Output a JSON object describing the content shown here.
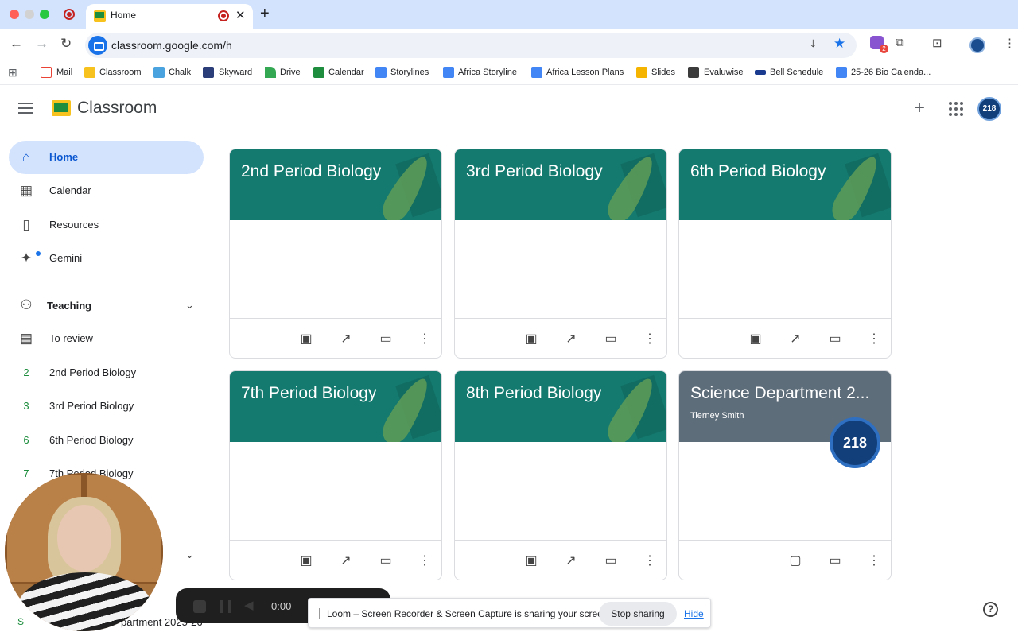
{
  "browser": {
    "tab_title": "Home",
    "url": "classroom.google.com/h",
    "bookmarks": [
      "Mail",
      "Classroom",
      "Chalk",
      "Skyward",
      "Drive",
      "Calendar",
      "Storylines",
      "Africa Storyline",
      "Africa Lesson Plans",
      "Slides",
      "Evaluwise",
      "Bell Schedule",
      "25-26 Bio Calenda..."
    ],
    "extension_badge": "2"
  },
  "app": {
    "title": "Classroom",
    "avatar_text": "218"
  },
  "sidebar": {
    "nav": [
      {
        "label": "Home",
        "icon": "home-icon"
      },
      {
        "label": "Calendar",
        "icon": "calendar-icon"
      },
      {
        "label": "Resources",
        "icon": "resources-icon"
      },
      {
        "label": "Gemini",
        "icon": "gemini-icon"
      }
    ],
    "teaching_label": "Teaching",
    "to_review": "To review",
    "classes": [
      {
        "letter": "2",
        "label": "2nd Period Biology"
      },
      {
        "letter": "3",
        "label": "3rd Period Biology"
      },
      {
        "letter": "6",
        "label": "6th Period Biology"
      },
      {
        "letter": "7",
        "label": "7th Period Biology"
      }
    ],
    "bottom_letter": "S",
    "bottom_label": "partment 2025-26"
  },
  "cards": [
    {
      "title": "2nd Period Biology",
      "subtitle": ""
    },
    {
      "title": "3rd Period Biology",
      "subtitle": ""
    },
    {
      "title": "6th Period Biology",
      "subtitle": ""
    },
    {
      "title": "7th Period Biology",
      "subtitle": ""
    },
    {
      "title": "8th Period Biology",
      "subtitle": ""
    },
    {
      "title": "Science Department 2...",
      "subtitle": "Tierney Smith",
      "badge": "218"
    }
  ],
  "loom": {
    "time": "0:00",
    "share_text": "Loom – Screen Recorder & Screen Capture is sharing your screen.",
    "stop_label": "Stop sharing",
    "hide_label": "Hide"
  },
  "help_label": "?",
  "colors": {
    "card_teal": "#14796e",
    "card_grey": "#5e6d7a",
    "active_nav": "#d3e3fd",
    "accent_blue": "#0b57d0"
  }
}
